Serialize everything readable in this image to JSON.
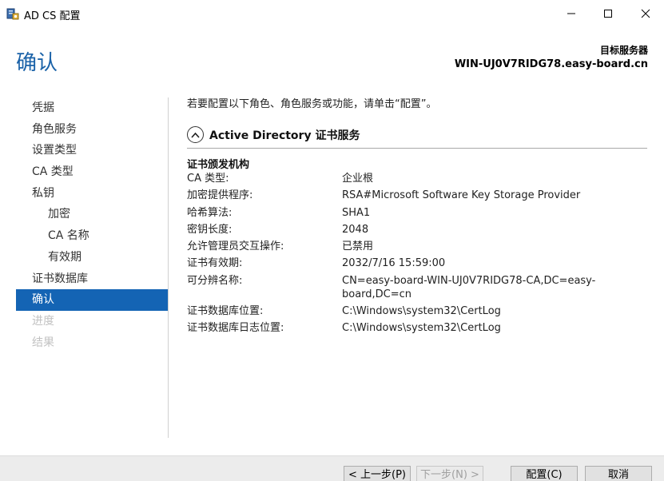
{
  "window": {
    "title": "AD CS 配置",
    "icon": "server-config-icon"
  },
  "header": {
    "page_title": "确认",
    "target_label": "目标服务器",
    "target_server": "WIN-UJ0V7RIDG78.easy-board.cn"
  },
  "nav": {
    "items": [
      {
        "label": "凭据",
        "state": "normal"
      },
      {
        "label": "角色服务",
        "state": "normal"
      },
      {
        "label": "设置类型",
        "state": "normal"
      },
      {
        "label": "CA 类型",
        "state": "normal"
      },
      {
        "label": "私钥",
        "state": "normal"
      },
      {
        "label": "加密",
        "state": "sub"
      },
      {
        "label": "CA 名称",
        "state": "sub"
      },
      {
        "label": "有效期",
        "state": "sub"
      },
      {
        "label": "证书数据库",
        "state": "normal"
      },
      {
        "label": "确认",
        "state": "active"
      },
      {
        "label": "进度",
        "state": "disabled"
      },
      {
        "label": "结果",
        "state": "disabled"
      }
    ]
  },
  "main": {
    "instruction": "若要配置以下角色、角色服务或功能，请单击“配置”。",
    "section_title": "Active Directory 证书服务",
    "group_title": "证书颁发机构",
    "details": [
      {
        "key": "CA 类型:",
        "value": "企业根"
      },
      {
        "key": "加密提供程序:",
        "value": "RSA#Microsoft Software Key Storage Provider"
      },
      {
        "key": "哈希算法:",
        "value": "SHA1"
      },
      {
        "key": "密钥长度:",
        "value": "2048"
      },
      {
        "key": "允许管理员交互操作:",
        "value": "已禁用"
      },
      {
        "key": "证书有效期:",
        "value": "2032/7/16 15:59:00"
      },
      {
        "key": "可分辨名称:",
        "value": "CN=easy-board-WIN-UJ0V7RIDG78-CA,DC=easy-board,DC=cn"
      },
      {
        "key": "证书数据库位置:",
        "value": "C:\\Windows\\system32\\CertLog"
      },
      {
        "key": "证书数据库日志位置:",
        "value": "C:\\Windows\\system32\\CertLog"
      }
    ]
  },
  "buttons": {
    "prev": "< 上一步(P)",
    "next": "下一步(N) >",
    "configure": "配置(C)",
    "cancel": "取消"
  },
  "colors": {
    "accent": "#1464b4",
    "title_blue": "#1a62a8",
    "disabled_text": "#c2c2c2"
  }
}
